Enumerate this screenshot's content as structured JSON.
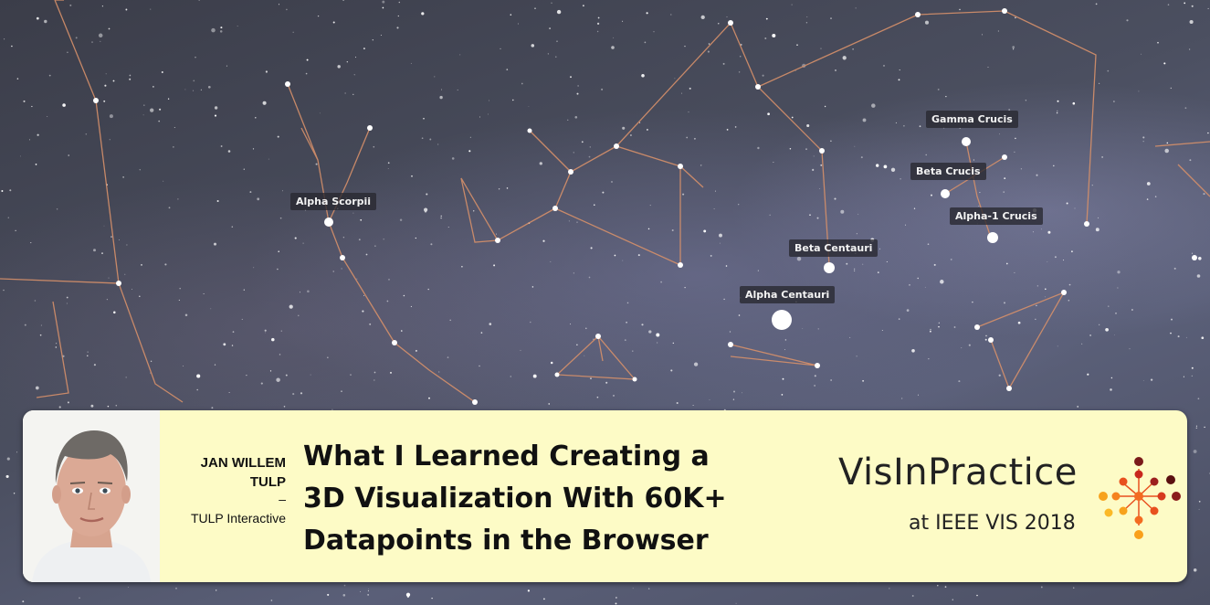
{
  "stars": {
    "labels": [
      "Alpha Scorpii",
      "Beta Centauri",
      "Alpha Centauri",
      "Gamma Crucis",
      "Beta Crucis",
      "Alpha-1 Crucis"
    ]
  },
  "banner": {
    "speaker_name_line1": "JAN WILLEM",
    "speaker_name_line2": "TULP",
    "separator": "–",
    "company": "TULP Interactive",
    "talk_title_line1": "What I Learned Creating a",
    "talk_title_line2": "3D Visualization With 60K+",
    "talk_title_line3": "Datapoints in the Browser",
    "logo_name": "VisInPractice",
    "logo_sub": "at IEEE VIS 2018"
  },
  "colors": {
    "banner_bg": "#fdfbc6",
    "constellation_line": "#d6906a",
    "logo_accent": "#e8501e"
  }
}
